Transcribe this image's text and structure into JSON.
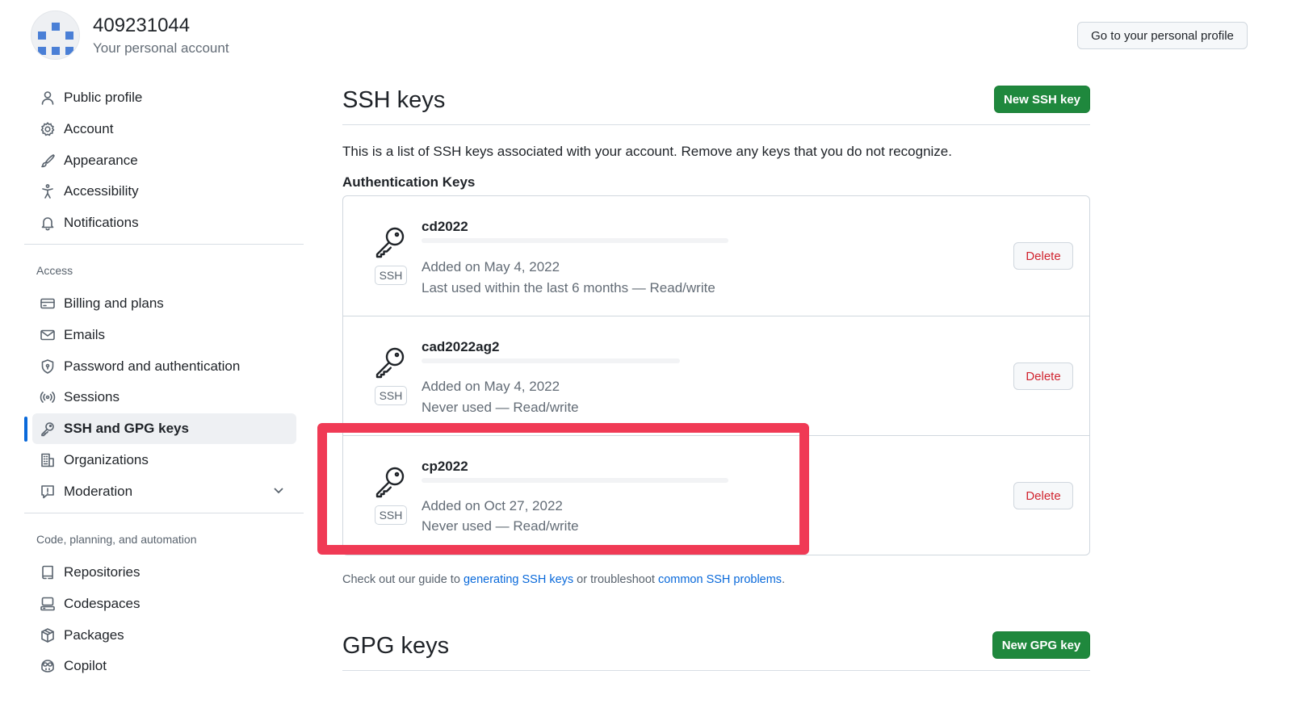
{
  "header": {
    "account_name": "409231044",
    "account_sub": "Your personal account",
    "profile_button": "Go to your personal profile"
  },
  "sidebar": {
    "items_top": [
      {
        "label": "Public profile",
        "icon": "person-icon"
      },
      {
        "label": "Account",
        "icon": "gear-icon"
      },
      {
        "label": "Appearance",
        "icon": "paintbrush-icon"
      },
      {
        "label": "Accessibility",
        "icon": "accessibility-icon"
      },
      {
        "label": "Notifications",
        "icon": "bell-icon"
      }
    ],
    "access_heading": "Access",
    "items_access": [
      {
        "label": "Billing and plans",
        "icon": "credit-card-icon"
      },
      {
        "label": "Emails",
        "icon": "mail-icon"
      },
      {
        "label": "Password and authentication",
        "icon": "shield-lock-icon"
      },
      {
        "label": "Sessions",
        "icon": "broadcast-icon"
      },
      {
        "label": "SSH and GPG keys",
        "icon": "key-icon",
        "active": true
      },
      {
        "label": "Organizations",
        "icon": "organization-icon"
      },
      {
        "label": "Moderation",
        "icon": "report-icon"
      }
    ],
    "code_heading": "Code, planning, and automation",
    "items_code": [
      {
        "label": "Repositories",
        "icon": "repo-icon"
      },
      {
        "label": "Codespaces",
        "icon": "codespaces-icon"
      },
      {
        "label": "Packages",
        "icon": "package-icon"
      },
      {
        "label": "Copilot",
        "icon": "copilot-icon"
      }
    ]
  },
  "ssh": {
    "title": "SSH keys",
    "new_button": "New SSH key",
    "intro": "This is a list of SSH keys associated with your account. Remove any keys that you do not recognize.",
    "subheading": "Authentication Keys",
    "badge": "SSH",
    "delete_label": "Delete",
    "keys": [
      {
        "title": "cd2022",
        "added": "Added on May 4, 2022",
        "used": "Last used within the last 6 months — Read/write"
      },
      {
        "title": "cad2022ag2",
        "added": "Added on May 4, 2022",
        "used": "Never used — Read/write"
      },
      {
        "title": "cp2022",
        "added": "Added on Oct 27, 2022",
        "used": "Never used — Read/write"
      }
    ],
    "guide_pre": "Check out our guide to ",
    "guide_link1": "generating SSH keys",
    "guide_mid": " or troubleshoot ",
    "guide_link2": "common SSH problems",
    "guide_post": "."
  },
  "gpg": {
    "title": "GPG keys",
    "new_button": "New GPG key"
  },
  "colors": {
    "accent_green": "#1f883d",
    "active_blue": "#0969da",
    "danger_red": "#d1242f",
    "highlight_red": "#f03a55"
  }
}
